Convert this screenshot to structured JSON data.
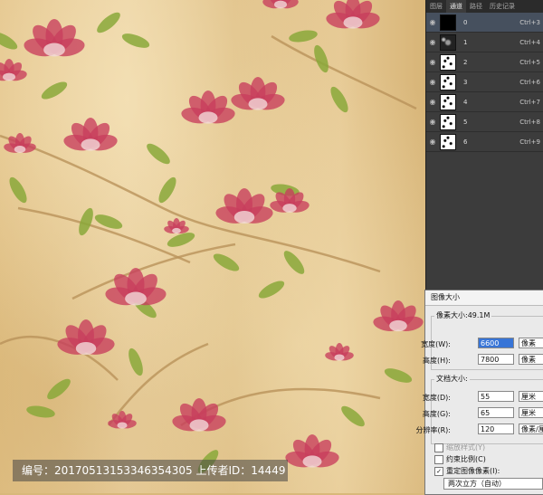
{
  "layers_panel": {
    "tabs": [
      "图层",
      "通道",
      "路径",
      "历史记录"
    ],
    "active_tab": "通道",
    "channels": [
      {
        "name": "0",
        "shortcut": "Ctrl+3"
      },
      {
        "name": "1",
        "shortcut": "Ctrl+4"
      },
      {
        "name": "2",
        "shortcut": "Ctrl+5"
      },
      {
        "name": "3",
        "shortcut": "Ctrl+6"
      },
      {
        "name": "4",
        "shortcut": "Ctrl+7"
      },
      {
        "name": "5",
        "shortcut": "Ctrl+8"
      },
      {
        "name": "6",
        "shortcut": "Ctrl+9"
      }
    ]
  },
  "image_size_dialog": {
    "title": "图像大小",
    "pixel_dimensions_label": "像素大小:49.1M",
    "width_label": "宽度(W):",
    "width_value": "6600",
    "width_unit": "像素",
    "height_label": "高度(H):",
    "height_value": "7800",
    "height_unit": "像素",
    "document_size_label": "文档大小:",
    "doc_width_label": "宽度(D):",
    "doc_width_value": "55",
    "doc_width_unit": "厘米",
    "doc_height_label": "高度(G):",
    "doc_height_value": "65",
    "doc_height_unit": "厘米",
    "resolution_label": "分辨率(R):",
    "resolution_value": "120",
    "resolution_unit": "像素/厘",
    "scale_styles_label": "缩放样式(Y)",
    "constrain_label": "约束比例(C)",
    "resample_label": "重定图像像素(I):",
    "resample_method": "两次立方（自动）"
  },
  "watermark": {
    "text": "编号：20170513153346354305 上传者ID：14449"
  },
  "colors": {
    "background": "#dcbb80",
    "petal": "#c83d5c",
    "leaf": "#8aa83a",
    "panel": "#3c3c3c"
  }
}
